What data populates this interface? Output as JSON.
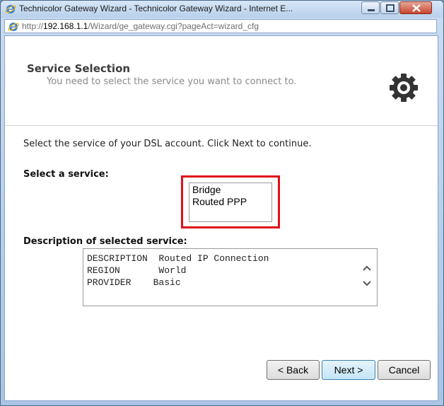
{
  "window": {
    "title": "Technicolor Gateway Wizard - Technicolor Gateway Wizard - Internet E...",
    "controls": [
      "minimize-icon",
      "maximize-icon",
      "close-icon"
    ]
  },
  "address": {
    "prefix": "http://",
    "host": "192.168.1.1",
    "path": "/Wizard/ge_gateway.cgi?pageAct=wizard_cfg"
  },
  "header": {
    "title": "Service Selection",
    "subtitle": "You need to select the service you want to connect to.",
    "icon": "gear-icon"
  },
  "body": {
    "instruction": "Select the service of your DSL account. Click Next to continue.",
    "select_label": "Select a service:",
    "services": [
      "Bridge",
      "Routed PPP"
    ],
    "description_label": "Description of selected service:",
    "description": [
      "DESCRIPTION  Routed IP Connection",
      "REGION       World",
      "PROVIDER    Basic"
    ]
  },
  "buttons": {
    "back": "< Back",
    "next": "Next >",
    "cancel": "Cancel"
  },
  "colors": {
    "highlight": "#e0101a",
    "next_accent": "#3c7fb1"
  }
}
